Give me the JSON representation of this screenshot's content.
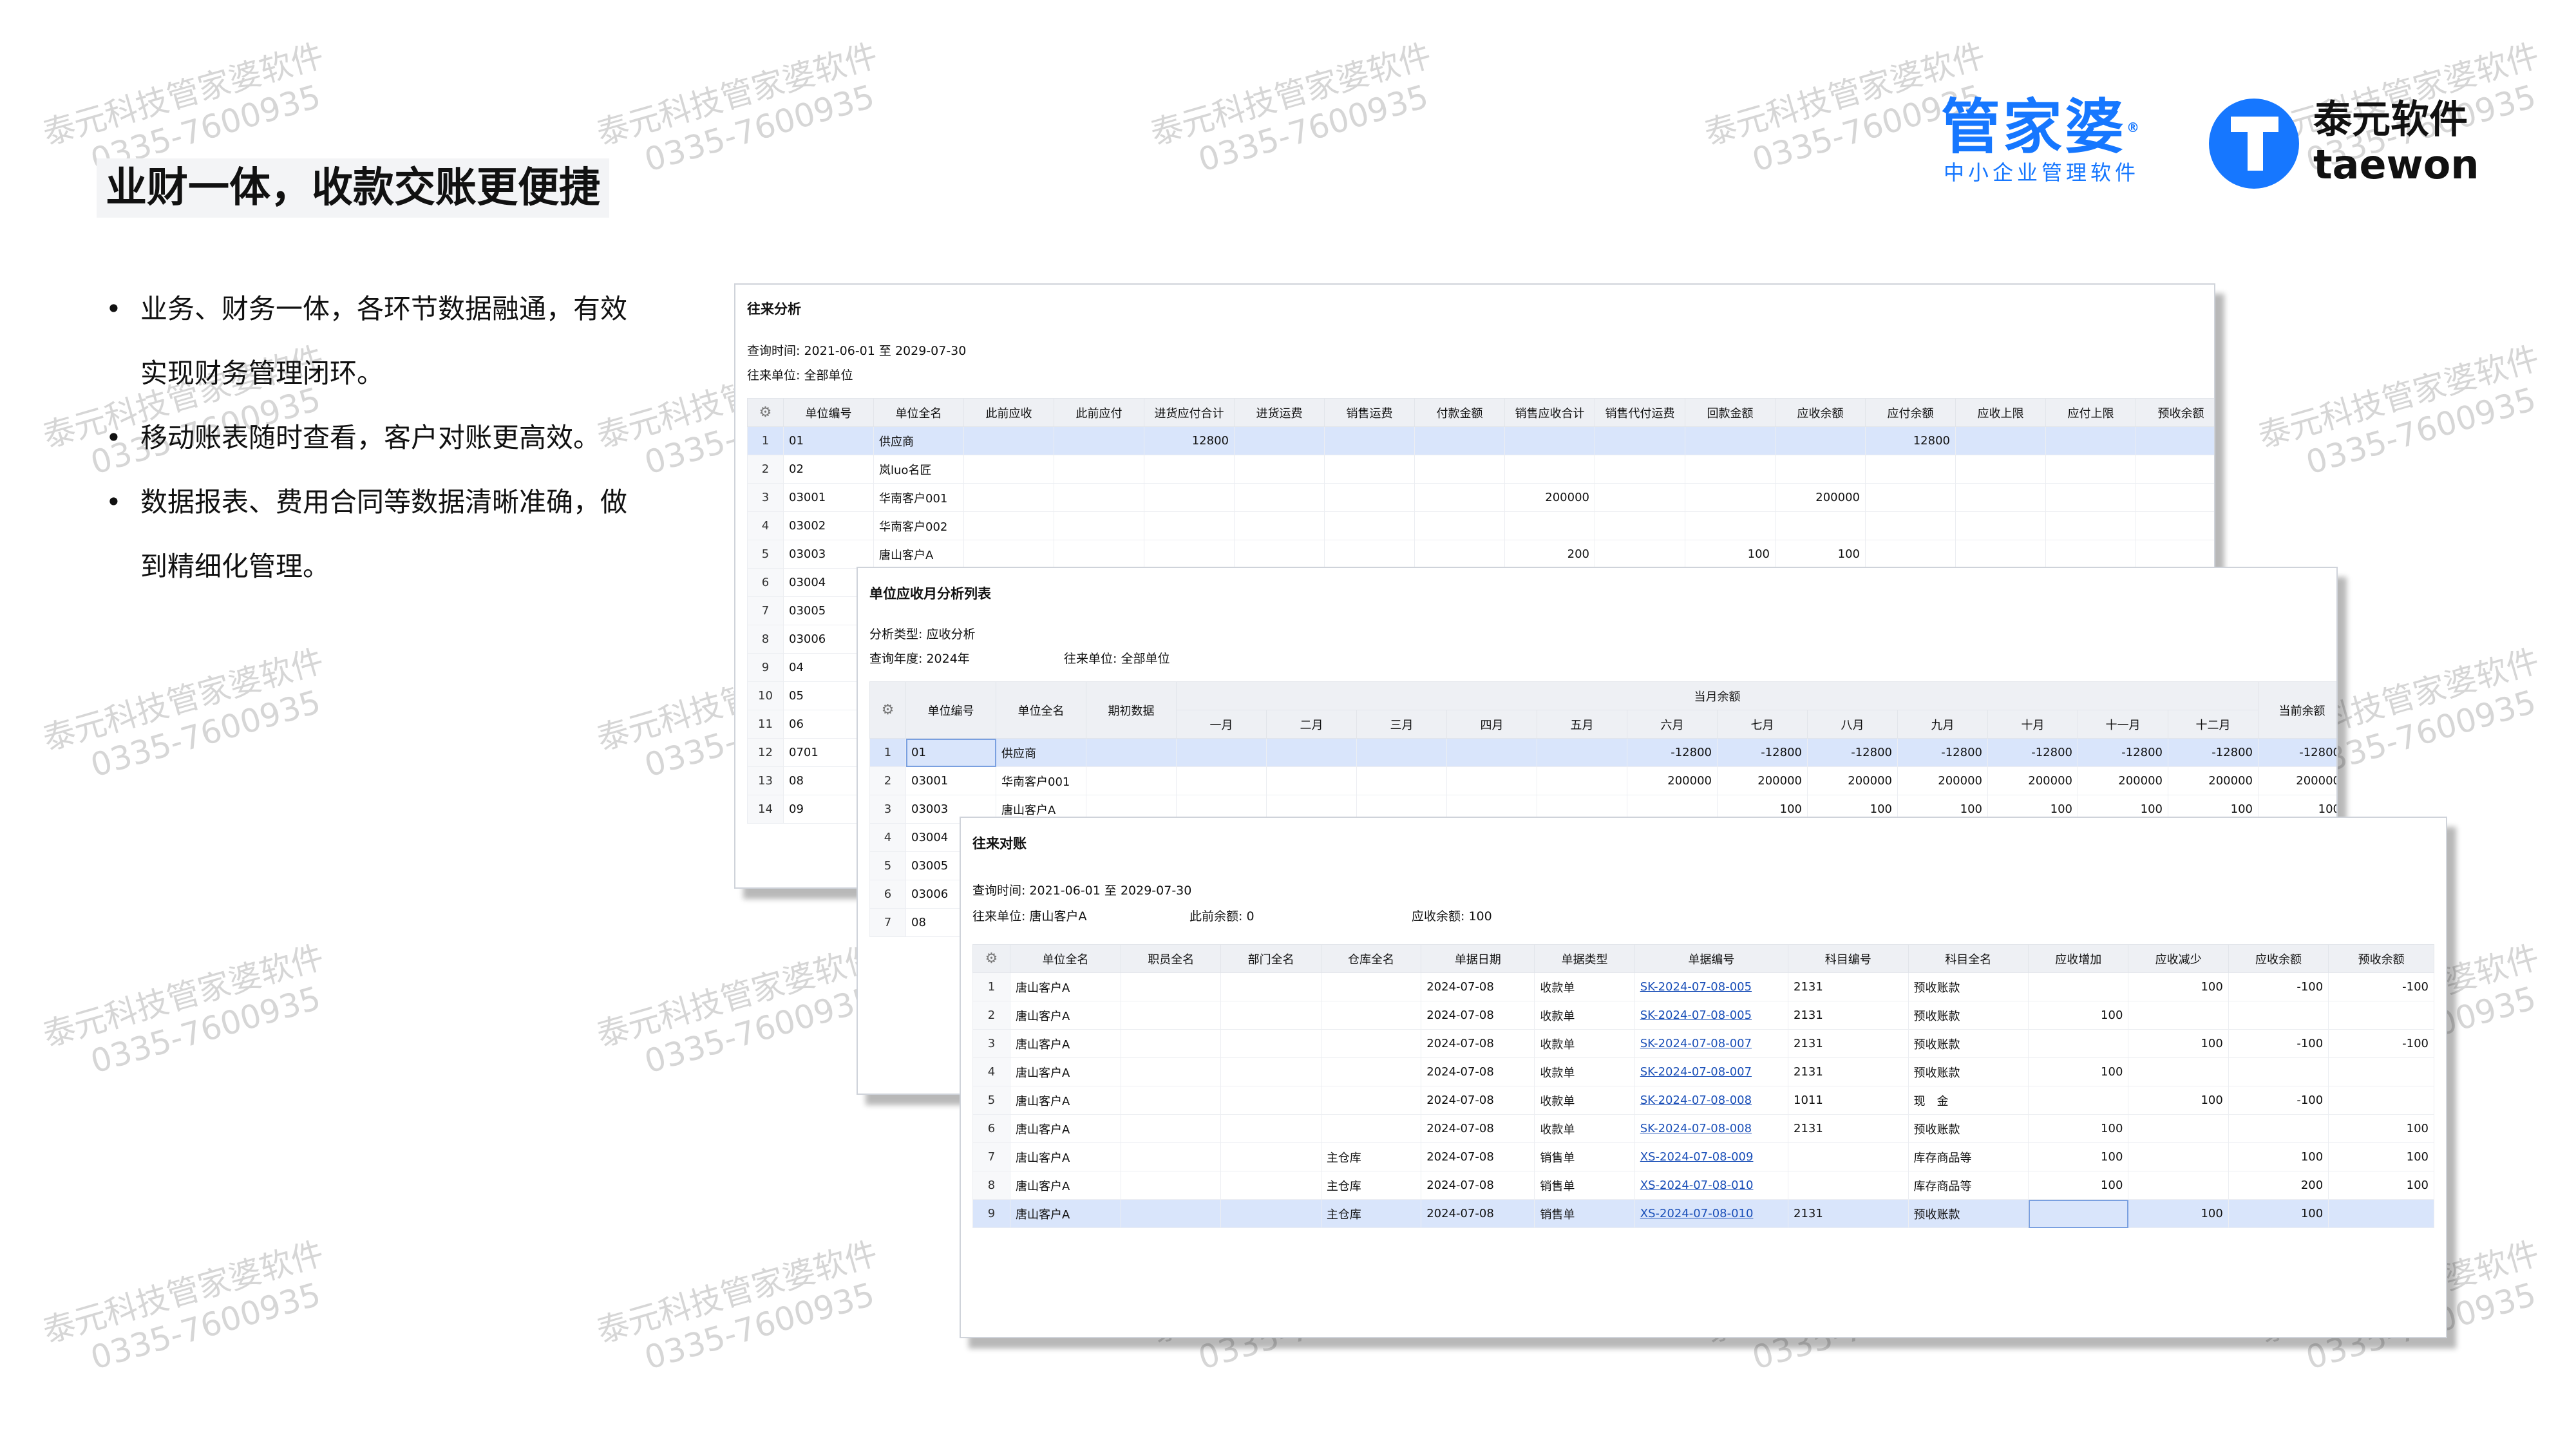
{
  "watermark": {
    "line1": "泰元科技管家婆软件",
    "line2": "0335-7600935"
  },
  "page_title": "业财一体，收款交账更便捷",
  "logos": {
    "gjp_main": "管家婆",
    "gjp_registered": "®",
    "gjp_sub": "中小企业管理软件",
    "taewon_cn": "泰元软件",
    "taewon_en": "taewon"
  },
  "bullets": [
    {
      "line1": "业务、财务一体，各环节数据融通，有效",
      "line2": "实现财务管理闭环。"
    },
    {
      "line1": "移动账表随时查看，客户对账更高效。",
      "line2": ""
    },
    {
      "line1": "数据报表、费用合同等数据清晰准确，做",
      "line2": "到精细化管理。"
    }
  ],
  "card1": {
    "title": "往来分析",
    "query_time": "查询时间: 2021-06-01 至 2029-07-30",
    "unit": "往来单位: 全部单位",
    "gear_icon": "⚙",
    "columns": [
      "单位编号",
      "单位全名",
      "此前应收",
      "此前应付",
      "进货应付合计",
      "进货运费",
      "销售运费",
      "付款金额",
      "销售应收合计",
      "销售代付运费",
      "回款金额",
      "应收余额",
      "应付余额",
      "应收上限",
      "应付上限",
      "预收余额"
    ],
    "rows": [
      {
        "idx": "1",
        "cells": [
          "01",
          "供应商",
          "",
          "",
          "12800",
          "",
          "",
          "",
          "",
          "",
          "",
          "",
          "12800",
          "",
          "",
          ""
        ],
        "selected": true
      },
      {
        "idx": "2",
        "cells": [
          "02",
          "岚luo名匠",
          "",
          "",
          "",
          "",
          "",
          "",
          "",
          "",
          "",
          "",
          "",
          "",
          "",
          ""
        ]
      },
      {
        "idx": "3",
        "cells": [
          "03001",
          "华南客户001",
          "",
          "",
          "",
          "",
          "",
          "",
          "200000",
          "",
          "",
          "200000",
          "",
          "",
          "",
          ""
        ]
      },
      {
        "idx": "4",
        "cells": [
          "03002",
          "华南客户002",
          "",
          "",
          "",
          "",
          "",
          "",
          "",
          "",
          "",
          "",
          "",
          "",
          "",
          ""
        ]
      },
      {
        "idx": "5",
        "cells": [
          "03003",
          "唐山客户A",
          "",
          "",
          "",
          "",
          "",
          "",
          "200",
          "",
          "100",
          "100",
          "",
          "",
          "",
          ""
        ]
      },
      {
        "idx": "6",
        "cells": [
          "03004",
          "",
          "",
          "",
          "",
          "",
          "",
          "",
          "",
          "",
          "",
          "",
          "",
          "",
          "",
          ""
        ]
      },
      {
        "idx": "7",
        "cells": [
          "03005",
          "",
          "",
          "",
          "",
          "",
          "",
          "",
          "",
          "",
          "",
          "",
          "",
          "",
          "",
          ""
        ]
      },
      {
        "idx": "8",
        "cells": [
          "03006",
          "",
          "",
          "",
          "",
          "",
          "",
          "",
          "",
          "",
          "",
          "",
          "",
          "",
          "",
          ""
        ]
      },
      {
        "idx": "9",
        "cells": [
          "04",
          "",
          "",
          "",
          "",
          "",
          "",
          "",
          "",
          "",
          "",
          "",
          "",
          "",
          "",
          ""
        ]
      },
      {
        "idx": "10",
        "cells": [
          "05",
          "",
          "",
          "",
          "",
          "",
          "",
          "",
          "",
          "",
          "",
          "",
          "",
          "",
          "",
          ""
        ]
      },
      {
        "idx": "11",
        "cells": [
          "06",
          "",
          "",
          "",
          "",
          "",
          "",
          "",
          "",
          "",
          "",
          "",
          "",
          "",
          "",
          ""
        ]
      },
      {
        "idx": "12",
        "cells": [
          "0701",
          "",
          "",
          "",
          "",
          "",
          "",
          "",
          "",
          "",
          "",
          "",
          "",
          "",
          "",
          ""
        ]
      },
      {
        "idx": "13",
        "cells": [
          "08",
          "",
          "",
          "",
          "",
          "",
          "",
          "",
          "",
          "",
          "",
          "",
          "",
          "",
          "",
          ""
        ]
      },
      {
        "idx": "14",
        "cells": [
          "09",
          "",
          "",
          "",
          "",
          "",
          "",
          "",
          "",
          "",
          "",
          "",
          "",
          "",
          "",
          ""
        ]
      }
    ]
  },
  "card2": {
    "title": "单位应收月分析列表",
    "analysis_type": "分析类型: 应收分析",
    "query_year": "查询年度: 2024年",
    "unit": "往来单位: 全部单位",
    "gear_icon": "⚙",
    "group_header": "当月余额",
    "columns_left": [
      "单位编号",
      "单位全名",
      "期初数据"
    ],
    "months": [
      "一月",
      "二月",
      "三月",
      "四月",
      "五月",
      "六月",
      "七月",
      "八月",
      "九月",
      "十月",
      "十一月",
      "十二月"
    ],
    "column_right": "当前余额",
    "rows": [
      {
        "idx": "1",
        "cells": [
          "01",
          "供应商",
          "",
          "",
          "",
          "",
          "",
          "",
          "-12800",
          "-12800",
          "-12800",
          "-12800",
          "-12800",
          "-12800",
          "-12800",
          "-12800"
        ],
        "selected": true
      },
      {
        "idx": "2",
        "cells": [
          "03001",
          "华南客户001",
          "",
          "",
          "",
          "",
          "",
          "",
          "200000",
          "200000",
          "200000",
          "200000",
          "200000",
          "200000",
          "200000",
          "200000"
        ]
      },
      {
        "idx": "3",
        "cells": [
          "03003",
          "唐山客户A",
          "",
          "",
          "",
          "",
          "",
          "",
          "",
          "100",
          "100",
          "100",
          "100",
          "100",
          "100",
          "100"
        ]
      },
      {
        "idx": "4",
        "cells": [
          "03004",
          "",
          "",
          "",
          "",
          "",
          "",
          "",
          "",
          "",
          "",
          "",
          "",
          "",
          "",
          ""
        ]
      },
      {
        "idx": "5",
        "cells": [
          "03005",
          "",
          "",
          "",
          "",
          "",
          "",
          "",
          "",
          "",
          "",
          "",
          "",
          "",
          "",
          ""
        ]
      },
      {
        "idx": "6",
        "cells": [
          "03006",
          "",
          "",
          "",
          "",
          "",
          "",
          "",
          "",
          "",
          "",
          "",
          "",
          "",
          "",
          ""
        ]
      },
      {
        "idx": "7",
        "cells": [
          "08",
          "",
          "",
          "",
          "",
          "",
          "",
          "",
          "",
          "",
          "",
          "",
          "",
          "",
          "",
          ""
        ]
      }
    ]
  },
  "card3": {
    "title": "往来对账",
    "query_time": "查询时间: 2021-06-01 至 2029-07-30",
    "unit": "往来单位: 唐山客户A",
    "prior_balance": "此前余额: 0",
    "receivable_balance": "应收余额: 100",
    "gear_icon": "⚙",
    "columns": [
      "单位全名",
      "职员全名",
      "部门全名",
      "仓库全名",
      "单据日期",
      "单据类型",
      "单据编号",
      "科目编号",
      "科目全名",
      "应收增加",
      "应收减少",
      "应收余额",
      "预收余额"
    ],
    "rows": [
      {
        "idx": "1",
        "cells": [
          "唐山客户A",
          "",
          "",
          "",
          "2024-07-08",
          "收款单",
          "SK-2024-07-08-005",
          "2131",
          "预收账款",
          "",
          "100",
          "-100",
          "-100"
        ]
      },
      {
        "idx": "2",
        "cells": [
          "唐山客户A",
          "",
          "",
          "",
          "2024-07-08",
          "收款单",
          "SK-2024-07-08-005",
          "2131",
          "预收账款",
          "100",
          "",
          "",
          ""
        ]
      },
      {
        "idx": "3",
        "cells": [
          "唐山客户A",
          "",
          "",
          "",
          "2024-07-08",
          "收款单",
          "SK-2024-07-08-007",
          "2131",
          "预收账款",
          "",
          "100",
          "-100",
          "-100"
        ]
      },
      {
        "idx": "4",
        "cells": [
          "唐山客户A",
          "",
          "",
          "",
          "2024-07-08",
          "收款单",
          "SK-2024-07-08-007",
          "2131",
          "预收账款",
          "100",
          "",
          "",
          ""
        ]
      },
      {
        "idx": "5",
        "cells": [
          "唐山客户A",
          "",
          "",
          "",
          "2024-07-08",
          "收款单",
          "SK-2024-07-08-008",
          "1011",
          "现　金",
          "",
          "100",
          "-100",
          ""
        ]
      },
      {
        "idx": "6",
        "cells": [
          "唐山客户A",
          "",
          "",
          "",
          "2024-07-08",
          "收款单",
          "SK-2024-07-08-008",
          "2131",
          "预收账款",
          "100",
          "",
          "",
          "100"
        ]
      },
      {
        "idx": "7",
        "cells": [
          "唐山客户A",
          "",
          "",
          "主仓库",
          "2024-07-08",
          "销售单",
          "XS-2024-07-08-009",
          "",
          "库存商品等",
          "100",
          "",
          "100",
          "100"
        ]
      },
      {
        "idx": "8",
        "cells": [
          "唐山客户A",
          "",
          "",
          "主仓库",
          "2024-07-08",
          "销售单",
          "XS-2024-07-08-010",
          "",
          "库存商品等",
          "100",
          "",
          "200",
          "100"
        ]
      },
      {
        "idx": "9",
        "cells": [
          "唐山客户A",
          "",
          "",
          "主仓库",
          "2024-07-08",
          "销售单",
          "XS-2024-07-08-010",
          "2131",
          "预收账款",
          "",
          "100",
          "100",
          ""
        ],
        "selected": true
      }
    ]
  }
}
